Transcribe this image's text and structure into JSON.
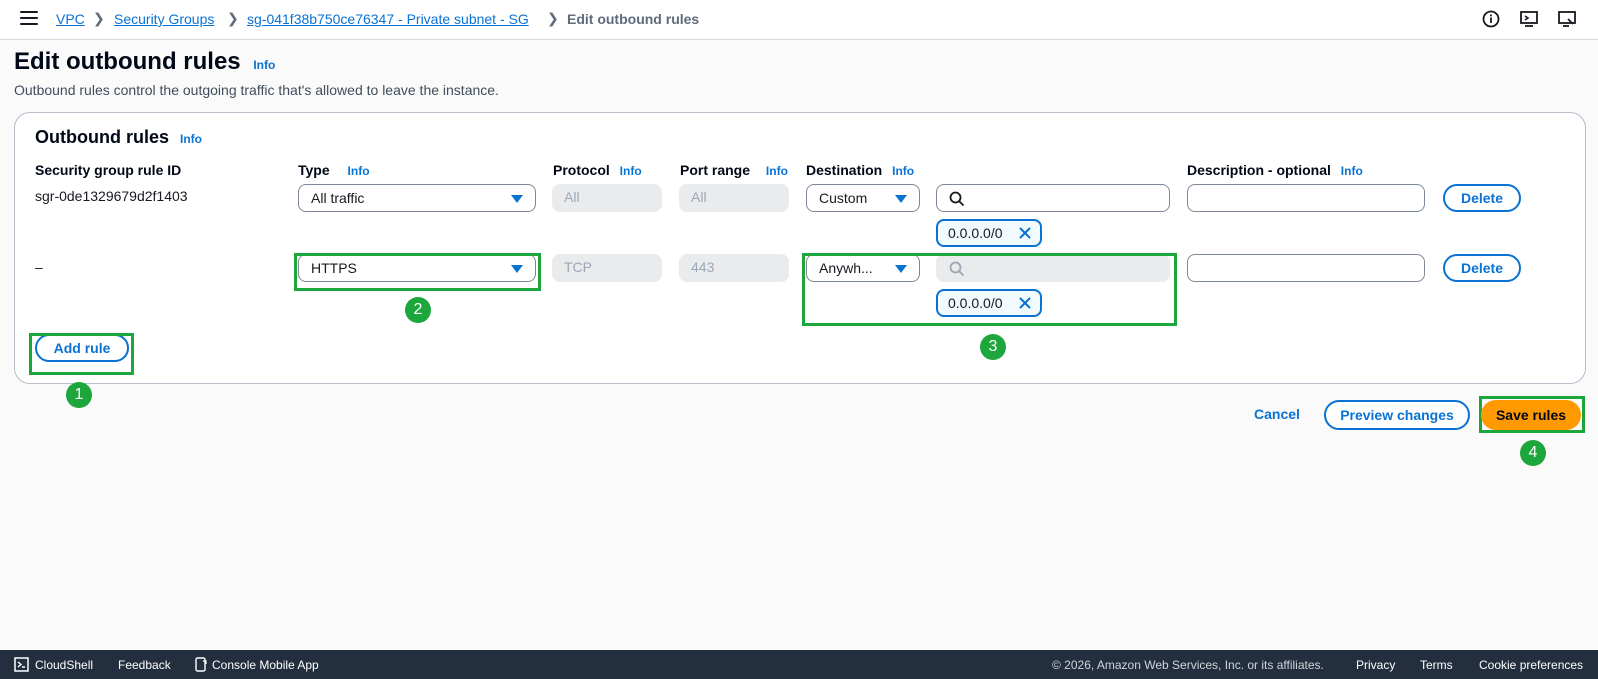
{
  "breadcrumb": {
    "items": [
      "VPC",
      "Security Groups",
      "sg-041f38b750ce76347 - Private subnet - SG"
    ],
    "current": "Edit outbound rules"
  },
  "page": {
    "title": "Edit outbound rules",
    "info": "Info",
    "description": "Outbound rules control the outgoing traffic that's allowed to leave the instance."
  },
  "card": {
    "title": "Outbound rules",
    "info": "Info"
  },
  "columns": {
    "rule_id": "Security group rule ID",
    "type": "Type",
    "protocol": "Protocol",
    "port_range": "Port range",
    "destination": "Destination",
    "description": "Description - optional",
    "info": "Info"
  },
  "rules": [
    {
      "id": "sgr-0de1329679d2f1403",
      "type": "All traffic",
      "protocol": "All",
      "port_range": "All",
      "destination": "Custom",
      "token": "0.0.0.0/0",
      "delete": "Delete"
    },
    {
      "id": "–",
      "type": "HTTPS",
      "protocol": "TCP",
      "port_range": "443",
      "destination": "Anywh...",
      "token": "0.0.0.0/0",
      "delete": "Delete"
    }
  ],
  "buttons": {
    "add_rule": "Add rule",
    "cancel": "Cancel",
    "preview": "Preview changes",
    "save": "Save rules"
  },
  "steps": [
    "1",
    "2",
    "3",
    "4"
  ],
  "colors": {
    "accent": "#0972d3",
    "primary_button": "#ff9900",
    "highlight": "#1ca63b",
    "footer_bg": "#232f3e"
  },
  "footer": {
    "cloudshell": "CloudShell",
    "feedback": "Feedback",
    "mobile_app": "Console Mobile App",
    "copyright": "© 2026, Amazon Web Services, Inc. or its affiliates.",
    "privacy": "Privacy",
    "terms": "Terms",
    "cookie": "Cookie preferences"
  }
}
